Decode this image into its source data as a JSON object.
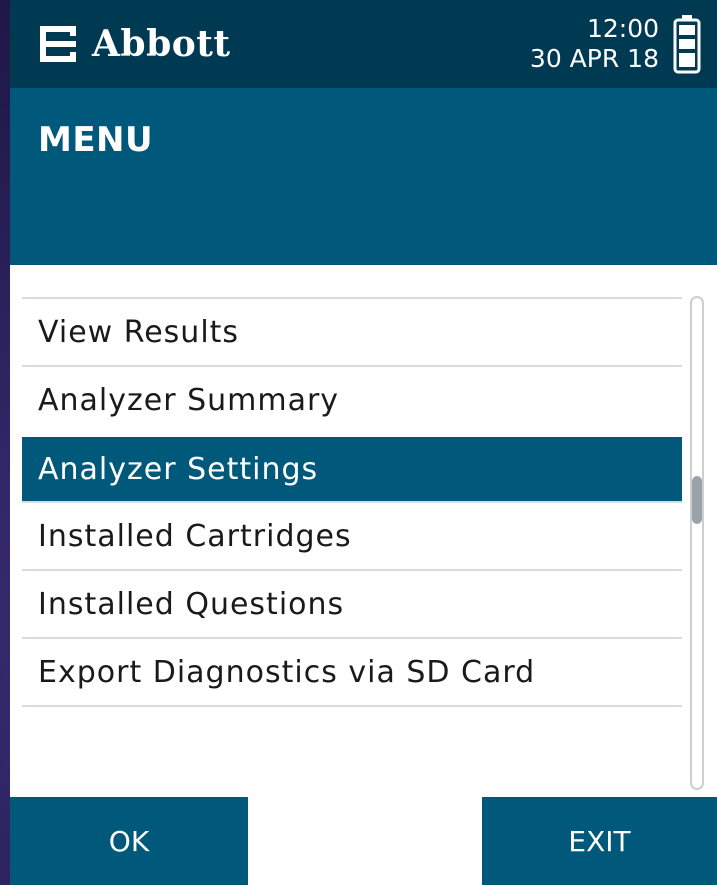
{
  "brand": {
    "name": "Abbott",
    "logo_icon": "abbott-logo-icon"
  },
  "status": {
    "time": "12:00",
    "date": "30 APR 18",
    "battery_icon": "battery-full-icon"
  },
  "screen": {
    "title": "MENU"
  },
  "menu": {
    "items": [
      {
        "label": "View Results"
      },
      {
        "label": "Analyzer Summary"
      },
      {
        "label": "Analyzer Settings"
      },
      {
        "label": "Installed Cartridges"
      },
      {
        "label": "Installed Questions"
      },
      {
        "label": "Export Diagnostics via SD Card"
      }
    ],
    "selected_index": 2
  },
  "scrollbar": {
    "position_fraction": 0.4
  },
  "softkeys": {
    "left": "OK",
    "right": "EXIT"
  },
  "colors": {
    "header": "#003a52",
    "primary": "#00597a",
    "text": "#1a1a1a",
    "divider": "#d9dde0"
  }
}
